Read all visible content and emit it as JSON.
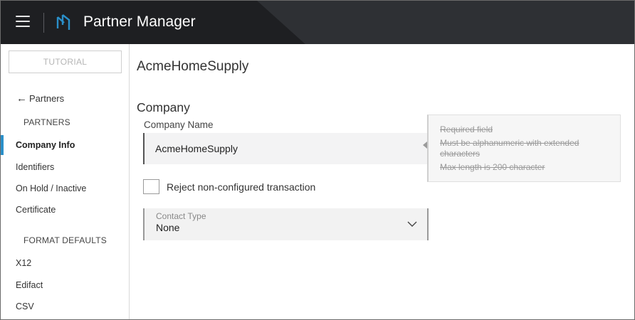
{
  "header": {
    "app_title": "Partner Manager",
    "menu_icon": "hamburger-menu-icon",
    "logo_icon": "partner-manager-logo-icon"
  },
  "sidebar": {
    "tutorial_label": "TUTORIAL",
    "back_label": "Partners",
    "back_icon": "arrow-left-icon",
    "partners_section": "PARTNERS",
    "partner_items": [
      {
        "label": "Company Info",
        "active": true
      },
      {
        "label": "Identifiers",
        "active": false
      },
      {
        "label": "On Hold / Inactive",
        "active": false
      },
      {
        "label": "Certificate",
        "active": false
      }
    ],
    "format_section": "FORMAT DEFAULTS",
    "format_items": [
      {
        "label": "X12"
      },
      {
        "label": "Edifact"
      },
      {
        "label": "CSV"
      }
    ]
  },
  "main": {
    "page_title": "AcmeHomeSupply",
    "section_title": "Company",
    "company_name_label": "Company Name",
    "company_name_value": "AcmeHomeSupply",
    "validation": {
      "rule_1": "Required field",
      "rule_2": "Must be alphanumeric with extended characters",
      "rule_3": "Max length is 200 character"
    },
    "reject_checkbox": {
      "label": "Reject non-configured transaction",
      "checked": false
    },
    "contact_type": {
      "label": "Contact Type",
      "value": "None",
      "icon": "chevron-down-icon"
    }
  },
  "colors": {
    "header_bg": "#1e1f22",
    "accent": "#2a8fc9",
    "input_bg": "#f3f3f4"
  }
}
